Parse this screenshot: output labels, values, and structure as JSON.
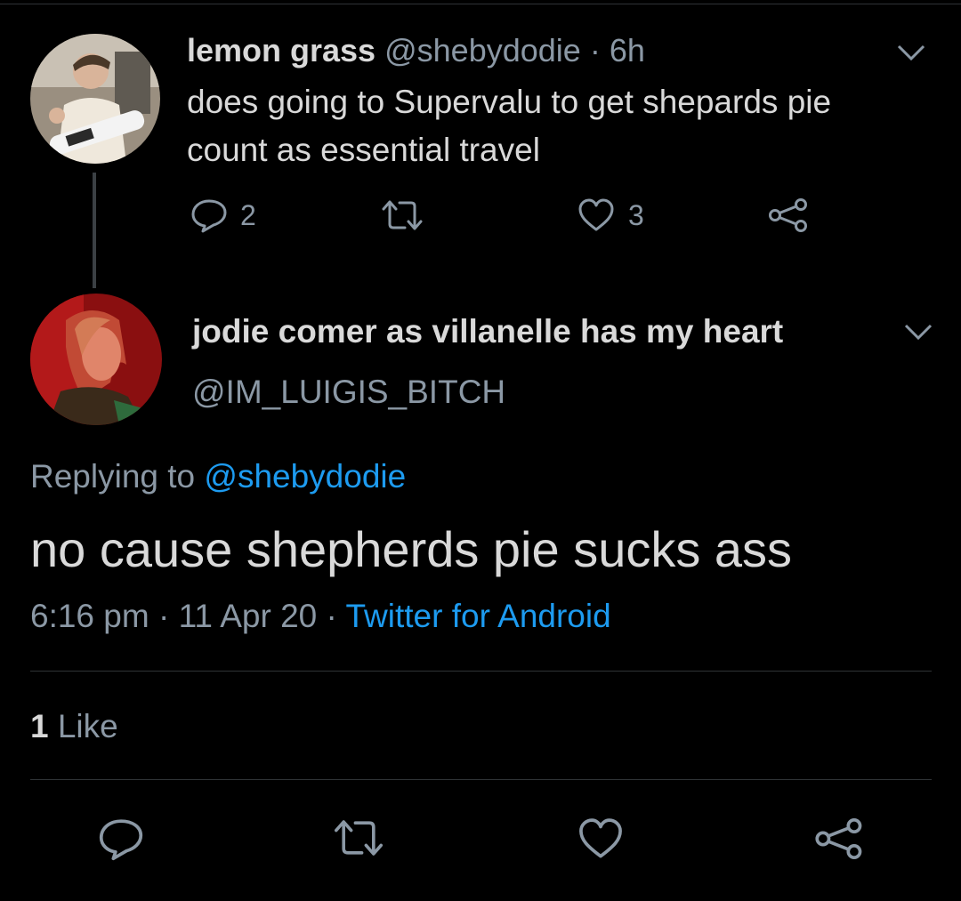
{
  "parent_tweet": {
    "display_name": "lemon grass",
    "handle": "@shebydodie",
    "separator": "·",
    "time_ago": "6h",
    "text": "does going to Supervalu to get shepards pie count as essential travel",
    "reply_count": "2",
    "like_count": "3",
    "icons": [
      "reply-icon",
      "retweet-icon",
      "like-icon",
      "share-icon",
      "chevron-down-icon"
    ]
  },
  "focus_tweet": {
    "display_name": "jodie comer as villanelle has my heart",
    "handle": "@IM_LUIGIS_BITCH",
    "replying_prefix": "Replying to",
    "replying_to": "@shebydodie",
    "text": "no cause shepherds pie sucks ass",
    "time": "6:16 pm",
    "date": "11 Apr 20",
    "separator": "·",
    "source": "Twitter for Android",
    "likes_count": "1",
    "likes_label": "Like"
  },
  "colors": {
    "background": "#000000",
    "text_primary": "#d9d9d9",
    "text_secondary": "#8b98a5",
    "link": "#1d9bf0",
    "divider": "#2f3336"
  }
}
